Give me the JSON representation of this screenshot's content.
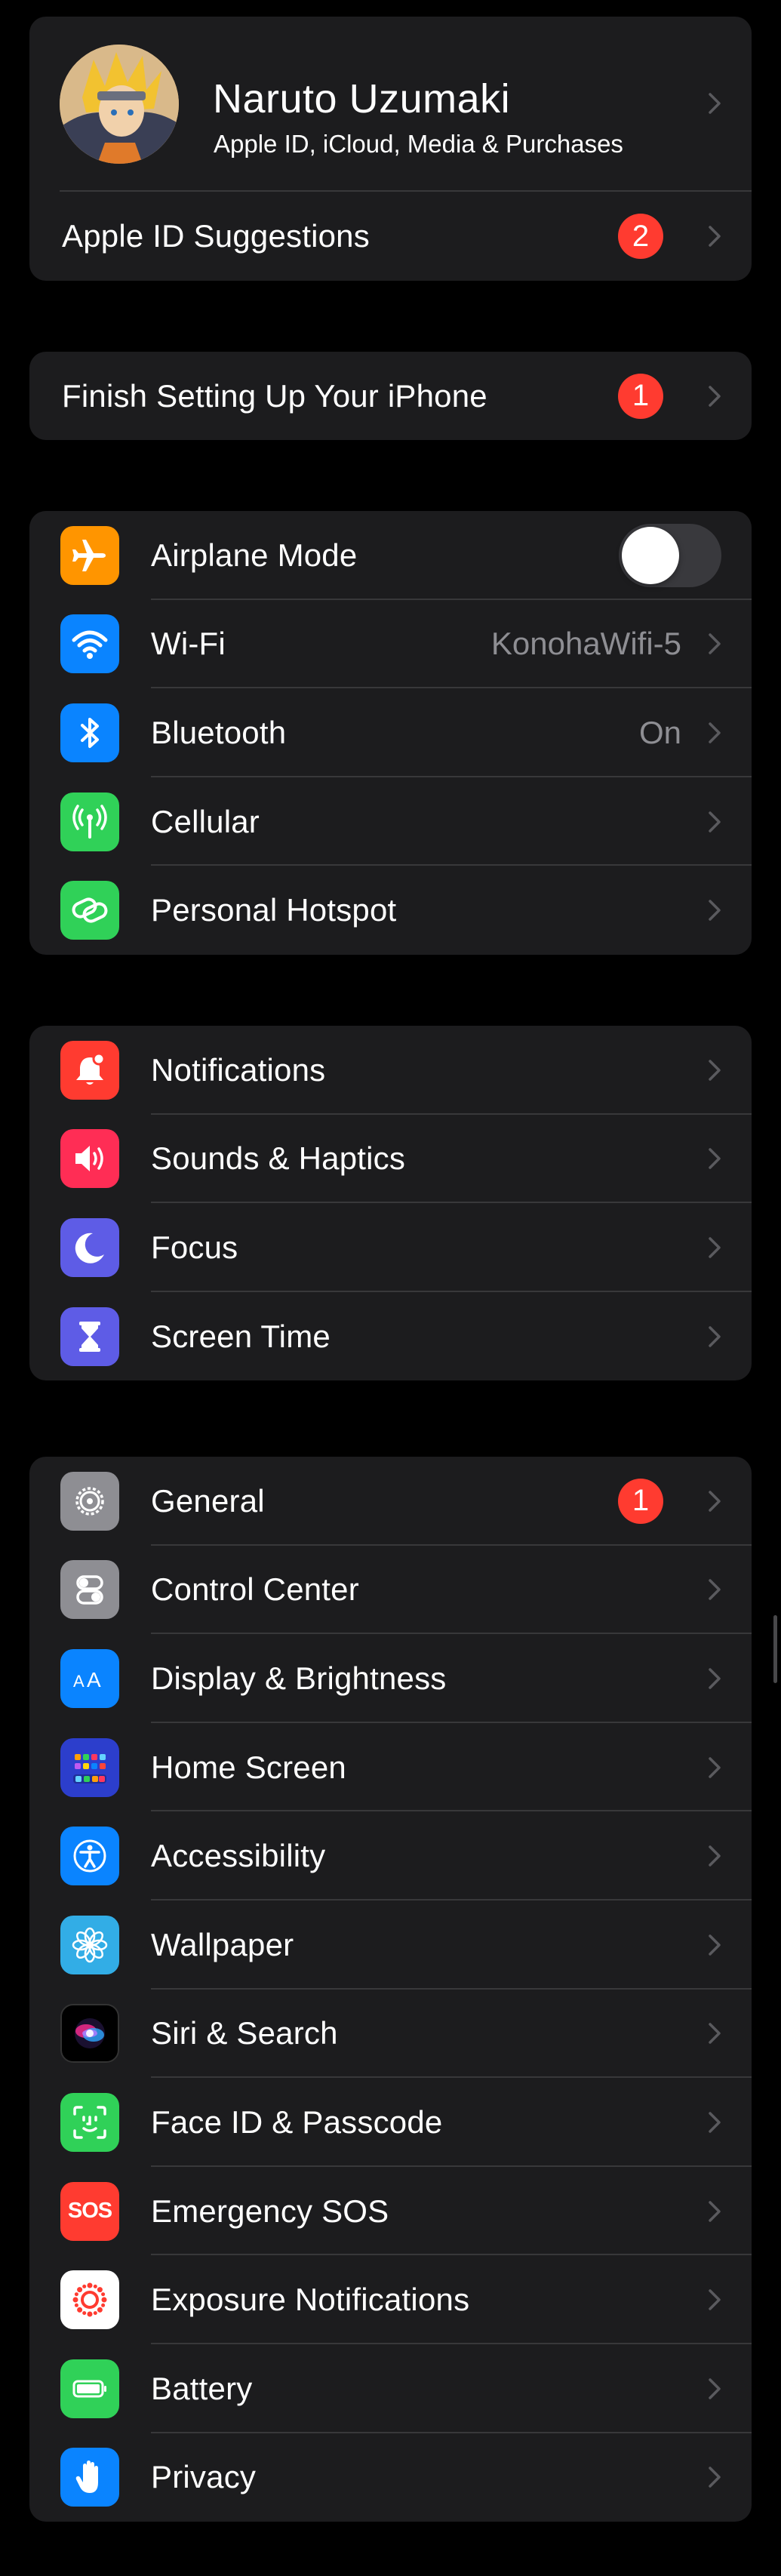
{
  "profile": {
    "name": "Naruto Uzumaki",
    "subtitle": "Apple ID, iCloud, Media & Purchases"
  },
  "apple_id_suggestions": {
    "label": "Apple ID Suggestions",
    "badge": "2"
  },
  "finish_setup": {
    "label": "Finish Setting Up Your iPhone",
    "badge": "1"
  },
  "connectivity": {
    "airplane_mode": {
      "label": "Airplane Mode",
      "enabled": false,
      "icon": "airplane-icon",
      "color": "#ff9500"
    },
    "wifi": {
      "label": "Wi-Fi",
      "value": "KonohaWifi-5",
      "icon": "wifi-icon",
      "color": "#0a84ff"
    },
    "bluetooth": {
      "label": "Bluetooth",
      "value": "On",
      "icon": "bluetooth-icon",
      "color": "#0a84ff"
    },
    "cellular": {
      "label": "Cellular",
      "icon": "cellular-icon",
      "color": "#30d158"
    },
    "hotspot": {
      "label": "Personal Hotspot",
      "icon": "hotspot-icon",
      "color": "#30d158"
    }
  },
  "attention": {
    "notifications": {
      "label": "Notifications",
      "icon": "bell-icon",
      "color": "#ff3b30"
    },
    "sounds": {
      "label": "Sounds & Haptics",
      "icon": "speaker-icon",
      "color": "#ff2d55"
    },
    "focus": {
      "label": "Focus",
      "icon": "moon-icon",
      "color": "#5e5ce6"
    },
    "screen_time": {
      "label": "Screen Time",
      "icon": "hourglass-icon",
      "color": "#5e5ce6"
    }
  },
  "system": {
    "general": {
      "label": "General",
      "badge": "1",
      "icon": "gear-icon",
      "color": "#8e8e93"
    },
    "control_center": {
      "label": "Control Center",
      "icon": "switches-icon",
      "color": "#8e8e93"
    },
    "display": {
      "label": "Display & Brightness",
      "icon": "text-size-icon",
      "color": "#0a84ff"
    },
    "home_screen": {
      "label": "Home Screen",
      "icon": "app-grid-icon",
      "color": "#2c3ecc"
    },
    "accessibility": {
      "label": "Accessibility",
      "icon": "accessibility-icon",
      "color": "#0a84ff"
    },
    "wallpaper": {
      "label": "Wallpaper",
      "icon": "flower-icon",
      "color": "#32ade6"
    },
    "siri": {
      "label": "Siri & Search",
      "icon": "siri-icon",
      "color": "#1c1c1e"
    },
    "face_id": {
      "label": "Face ID & Passcode",
      "icon": "face-id-icon",
      "color": "#30d158"
    },
    "sos": {
      "label": "Emergency SOS",
      "icon_text": "SOS",
      "icon": "sos-icon",
      "color": "#ff3b30"
    },
    "exposure": {
      "label": "Exposure Notifications",
      "icon": "exposure-icon",
      "color": "#ffffff"
    },
    "battery": {
      "label": "Battery",
      "icon": "battery-icon",
      "color": "#30d158"
    },
    "privacy": {
      "label": "Privacy",
      "icon": "hand-icon",
      "color": "#0a84ff"
    }
  }
}
